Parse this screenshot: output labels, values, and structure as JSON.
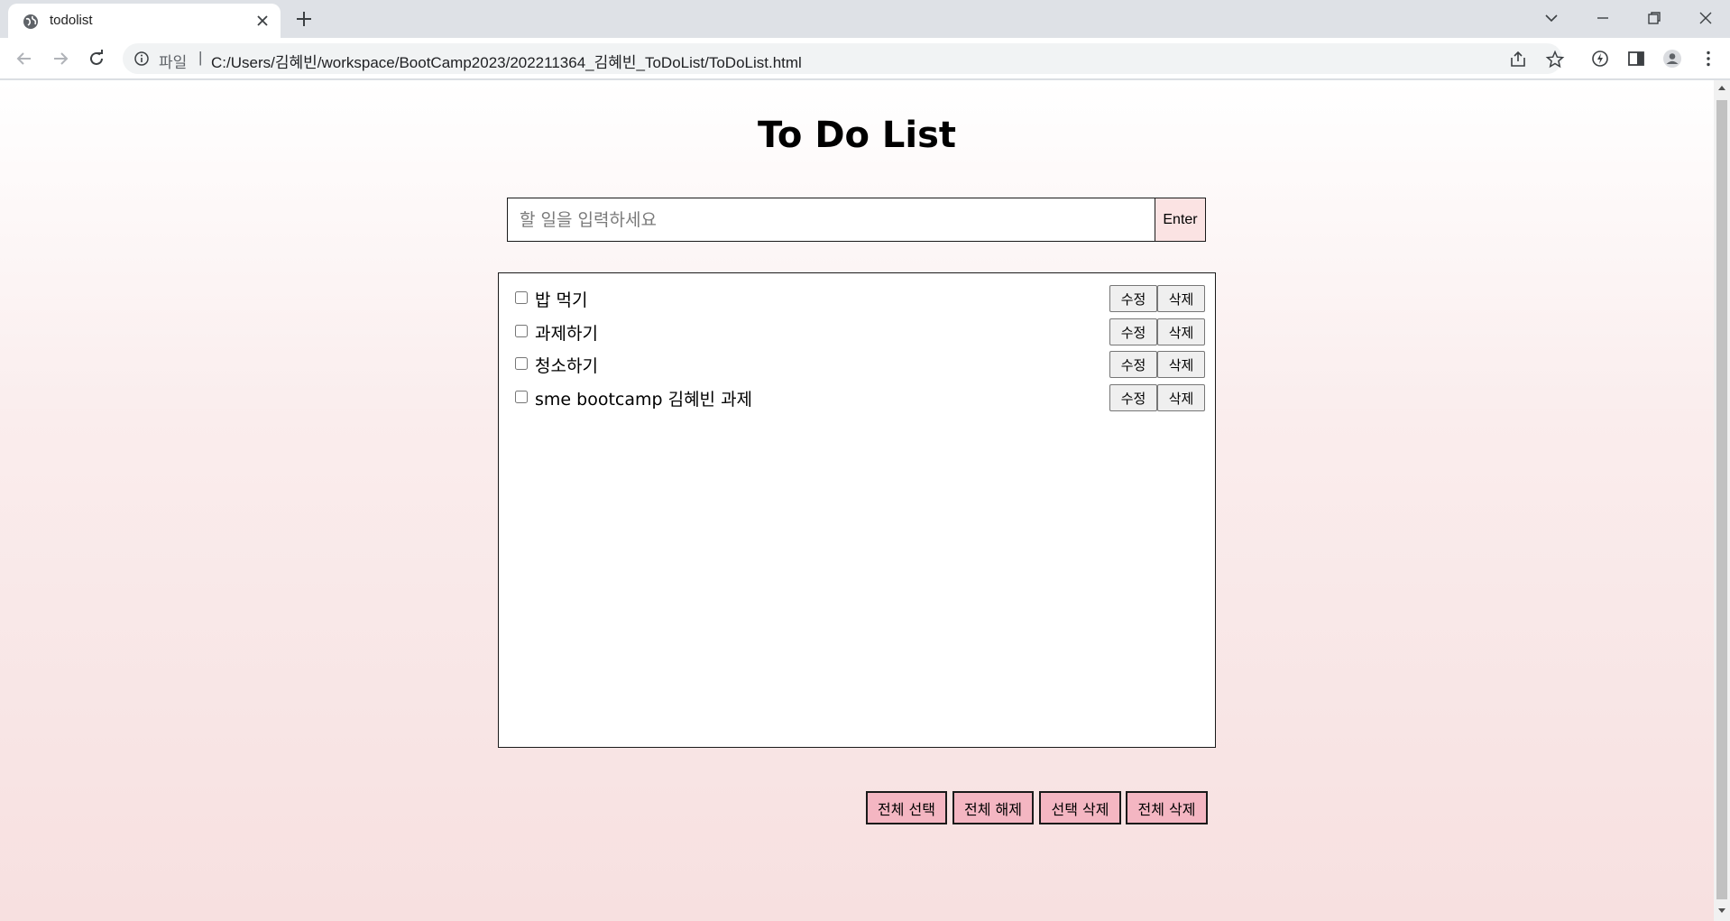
{
  "browser": {
    "tab_title": "todolist",
    "url_scheme": "파일",
    "url_separator": "|",
    "url": "C:/Users/김혜빈/workspace/BootCamp2023/202211364_김혜빈_ToDoList/ToDoList.html"
  },
  "page": {
    "title": "To Do List",
    "input_placeholder": "할 일을 입력하세요",
    "input_value": "",
    "enter_label": "Enter",
    "items": [
      {
        "text": "밥 먹기",
        "checked": false,
        "edit_label": "수정",
        "delete_label": "삭제"
      },
      {
        "text": "과제하기",
        "checked": false,
        "edit_label": "수정",
        "delete_label": "삭제"
      },
      {
        "text": "청소하기",
        "checked": false,
        "edit_label": "수정",
        "delete_label": "삭제"
      },
      {
        "text": "sme bootcamp 김혜빈 과제",
        "checked": false,
        "edit_label": "수정",
        "delete_label": "삭제"
      }
    ],
    "bottom_buttons": {
      "select_all": "전체 선택",
      "deselect_all": "전체 해제",
      "delete_selected": "선택 삭제",
      "delete_all": "전체 삭제"
    }
  },
  "colors": {
    "bottom_button_bg": "#f4b6c2",
    "enter_button_bg": "#fbe3e3",
    "page_gradient_end": "#f7e0e0"
  }
}
